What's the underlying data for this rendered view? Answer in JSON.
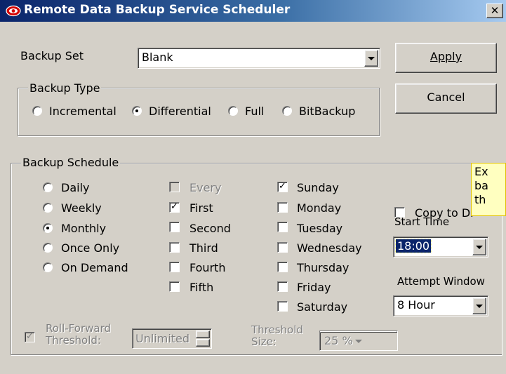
{
  "window": {
    "title": "Remote Data Backup Service Scheduler",
    "close_label": "✕"
  },
  "backup_set": {
    "label": "Backup Set",
    "value": "Blank"
  },
  "buttons": {
    "apply": "Apply",
    "cancel": "Cancel"
  },
  "backup_type": {
    "legend": "Backup Type",
    "options": [
      "Incremental",
      "Differential",
      "Full",
      "BitBackup"
    ],
    "selected": "Differential"
  },
  "backup_schedule": {
    "legend": "Backup Schedule",
    "frequency": {
      "options": [
        "Daily",
        "Weekly",
        "Monthly",
        "Once Only",
        "On Demand"
      ],
      "selected": "Monthly"
    },
    "occurrence": {
      "options": [
        "Every",
        "First",
        "Second",
        "Third",
        "Fourth",
        "Fifth"
      ],
      "checked": [
        "First"
      ],
      "disabled": [
        "Every"
      ]
    },
    "days": {
      "options": [
        "Sunday",
        "Monday",
        "Tuesday",
        "Wednesday",
        "Thursday",
        "Friday",
        "Saturday"
      ],
      "checked": [
        "Sunday"
      ]
    }
  },
  "copy_to_disk": {
    "label": "Copy to Di",
    "checked": false
  },
  "start_time": {
    "label": "Start Time",
    "value": "18:00"
  },
  "attempt_window": {
    "label": "Attempt Window",
    "value": "8 Hour"
  },
  "roll_forward": {
    "label_line1": "Roll-Forward",
    "label_line2": "Threshold:",
    "checked": true,
    "value": "Unlimited"
  },
  "threshold_size": {
    "label_line1": "Threshold",
    "label_line2": "Size:",
    "value": "25 %"
  },
  "tooltip": {
    "line1": "Ex",
    "line2": "ba",
    "line3": "th"
  },
  "colors": {
    "title_bar_start": "#0a246a",
    "title_bar_end": "#a6caf0",
    "dialog_face": "#d4d0c8",
    "tooltip_bg": "#ffffc0",
    "selection": "#0a246a"
  },
  "icons": {
    "app": "red-eye-logo-icon",
    "close": "close-icon",
    "dropdown": "chevron-down-icon",
    "spin": "spin-updown-icon"
  }
}
